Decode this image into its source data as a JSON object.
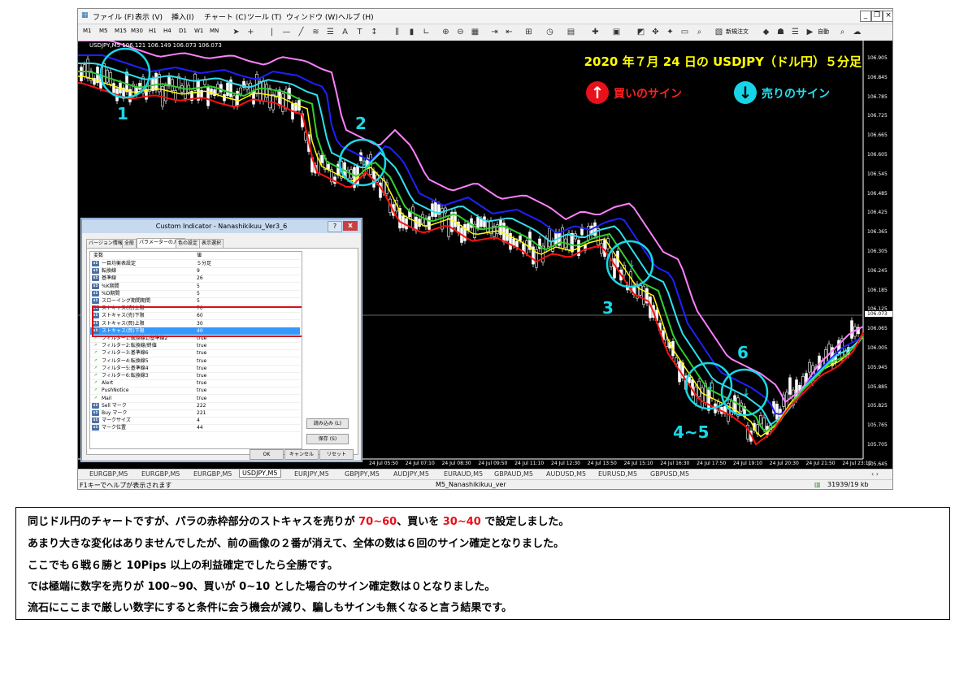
{
  "menu": {
    "file": "ファイル (F)",
    "view": "表示 (V)",
    "insert": "挿入(I)",
    "chart": "チャート (C)",
    "tools": "ツール (T)",
    "window": "ウィンドウ (W)",
    "help": "ヘルプ (H)"
  },
  "toolbar": {
    "timeframes": [
      "M1",
      "M5",
      "M15",
      "M30",
      "H1",
      "H4",
      "D1",
      "W1",
      "MN"
    ],
    "new_order": "新規注文",
    "autotrade": "自動"
  },
  "chart": {
    "symbol_info": "USDJPY,M5  106.121 106.149 106.073 106.073",
    "title": "2020 年７月 24 日の USDJPY（ドル円）５分足",
    "legend_buy": "買いのサイン",
    "legend_sell": "売りのサイン",
    "markers": [
      "1",
      "2",
      "3",
      "4~5",
      "6"
    ],
    "y_ticks": [
      "106.905",
      "106.845",
      "106.785",
      "106.725",
      "106.665",
      "106.605",
      "106.545",
      "106.485",
      "106.425",
      "106.365",
      "106.305",
      "106.245",
      "106.185",
      "106.125",
      "106.065",
      "106.005",
      "105.945",
      "105.885",
      "105.825",
      "105.765",
      "105.705",
      "105.645"
    ],
    "current_price": "106.073",
    "x_ticks": [
      "24 Jul 05:50",
      "24 Jul 07:10",
      "24 Jul 08:30",
      "24 Jul 09:50",
      "24 Jul 11:10",
      "24 Jul 12:30",
      "24 Jul 13:50",
      "24 Jul 15:10",
      "24 Jul 16:30",
      "24 Jul 17:50",
      "24 Jul 19:10",
      "24 Jul 20:30",
      "24 Jul 21:50",
      "24 Jul 23:10"
    ]
  },
  "tabs": [
    "EURGBP,M5",
    "EURGBP,M5",
    "EURGBP,M5",
    "USDJPY,M5",
    "EURJPY,M5",
    "GBPJPY,M5",
    "AUDJPY,M5",
    "EURAUD,M5",
    "GBPAUD,M5",
    "AUDUSD,M5",
    "EURUSD,M5",
    "GBPUSD,M5"
  ],
  "active_tab": 3,
  "status": {
    "help": "F1キーでヘルプが表示されます",
    "profile": "M5_Nanashikikuu_ver",
    "traffic": "31939/19 kb"
  },
  "dialog": {
    "title": "Custom Indicator - Nanashikikuu_Ver3_6",
    "help_btn": "?",
    "close_btn": "x",
    "tabs": [
      "バージョン情報",
      "全般",
      "パラメーターの入力",
      "色の設定",
      "表示選択"
    ],
    "col_var": "変数",
    "col_val": "値",
    "params": [
      {
        "icon": "ab",
        "name": "一目均衡表設定",
        "value": "５分足"
      },
      {
        "icon": "123",
        "name": "転換線",
        "value": "9"
      },
      {
        "icon": "123",
        "name": "基準線",
        "value": "26"
      },
      {
        "icon": "123",
        "name": "%K期間",
        "value": "5"
      },
      {
        "icon": "123",
        "name": "%D期間",
        "value": "5"
      },
      {
        "icon": "123",
        "name": "スローイング期間期間",
        "value": "5"
      },
      {
        "icon": "123",
        "name": "ストキャス(売)上限",
        "value": "70"
      },
      {
        "icon": "123",
        "name": "ストキャス(売)下限",
        "value": "60"
      },
      {
        "icon": "123",
        "name": "ストキャス(買)上限",
        "value": "30"
      },
      {
        "icon": "123",
        "name": "ストキャス(買)下限",
        "value": "40"
      },
      {
        "icon": "bool",
        "name": "フィルター1:転換線1/基準線2",
        "value": "true"
      },
      {
        "icon": "bool",
        "name": "フィルター2:転換線/終値",
        "value": "true"
      },
      {
        "icon": "bool",
        "name": "フィルター3:基準線6",
        "value": "true"
      },
      {
        "icon": "bool",
        "name": "フィルター4:転換線5",
        "value": "true"
      },
      {
        "icon": "bool",
        "name": "フィルター5:基準線4",
        "value": "true"
      },
      {
        "icon": "bool",
        "name": "フィルター6:転換線3",
        "value": "true"
      },
      {
        "icon": "bool",
        "name": "Alert",
        "value": "true"
      },
      {
        "icon": "bool",
        "name": "PushNotice",
        "value": "true"
      },
      {
        "icon": "bool",
        "name": "Mail",
        "value": "true"
      },
      {
        "icon": "123",
        "name": "Sell マーク",
        "value": "222"
      },
      {
        "icon": "123",
        "name": "Buy マーク",
        "value": "221"
      },
      {
        "icon": "123",
        "name": "マークサイズ",
        "value": "4"
      },
      {
        "icon": "123",
        "name": "マーク位置",
        "value": "44"
      }
    ],
    "selected_row": 9,
    "load_btn": "読み込み (L)",
    "save_btn": "保存 (S)",
    "ok_btn": "OK",
    "cancel_btn": "キャンセル",
    "reset_btn": "リセット"
  },
  "caption": {
    "line1_a": "同じドル円のチャートですが、パラの赤枠部分のストキャスを売りが ",
    "line1_b": "70~60",
    "line1_c": "、買いを ",
    "line1_d": "30~40",
    "line1_e": " で設定しました。",
    "line2": "あまり大きな変化はありませんでしたが、前の画像の２番が消えて、全体の数は６回のサイン確定となりました。",
    "line3": "ここでも６戦６勝と 10Pips 以上の利益確定でしたら全勝です。",
    "line4": "では極端に数字を売りが 100~90、買いが 0~10 とした場合のサイン確定数は０となりました。",
    "line5": "流石にここまで厳しい数字にすると条件に会う機会が減り、騙しもサインも無くなると言う結果です。"
  }
}
